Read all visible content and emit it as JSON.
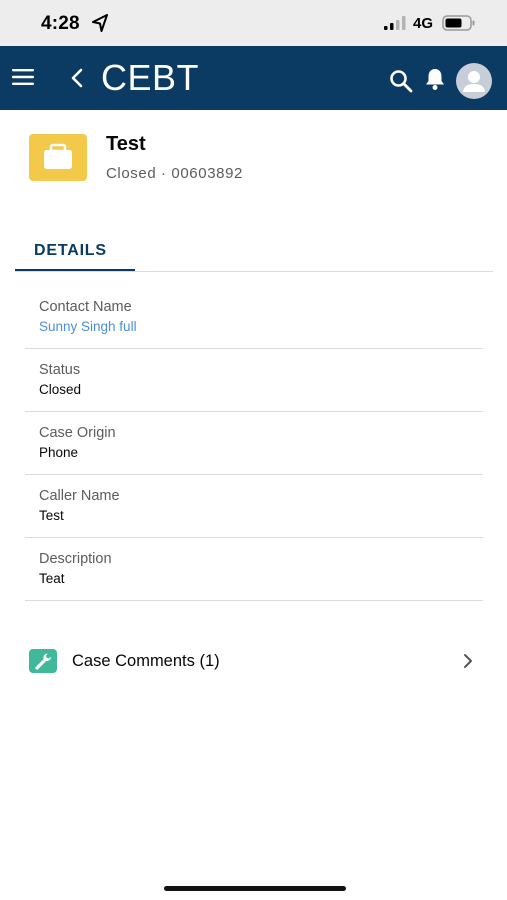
{
  "status_bar": {
    "time": "4:28",
    "network": "4G",
    "location_icon": "location-arrow-icon",
    "signal_icon": "cellular-signal-icon",
    "battery_icon": "battery-icon"
  },
  "nav": {
    "title": "CEBT",
    "menu_icon": "hamburger-menu-icon",
    "back_icon": "back-chevron-icon",
    "search_icon": "search-icon",
    "notifications_icon": "bell-icon",
    "avatar_icon": "user-avatar-icon",
    "color": "#0b3a62"
  },
  "record": {
    "icon": "briefcase-icon",
    "icon_color": "#f3c94a",
    "title": "Test",
    "subtitle": "Closed  ·  00603892"
  },
  "tabs": [
    {
      "label": "DETAILS",
      "active": true
    }
  ],
  "fields": [
    {
      "label": "Contact Name",
      "value": "Sunny Singh full"
    },
    {
      "label": "Status",
      "value": "Closed"
    },
    {
      "label": "Case Origin",
      "value": "Phone"
    },
    {
      "label": "Caller Name",
      "value": "Test"
    },
    {
      "label": "Description",
      "value": "Teat"
    }
  ],
  "related": {
    "icon": "wrench-icon",
    "icon_color": "#3fb99a",
    "label": "Case Comments (1)",
    "chevron_icon": "chevron-right-icon"
  }
}
